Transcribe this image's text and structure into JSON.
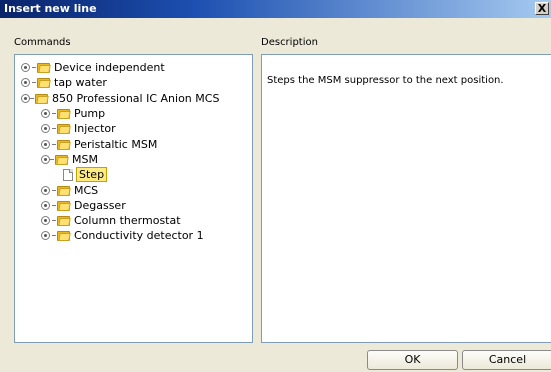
{
  "window": {
    "title": "Insert new line",
    "close_label": "X"
  },
  "commands_label": "Commands",
  "description_label": "Description",
  "description_text": "Steps the MSM suppressor to the next position.",
  "tree": [
    {
      "label": "Device independent",
      "level": 0,
      "type": "folder",
      "expanded": false
    },
    {
      "label": "tap water",
      "level": 0,
      "type": "folder",
      "expanded": false
    },
    {
      "label": "850 Professional IC Anion MCS",
      "level": 0,
      "type": "folder",
      "expanded": true
    },
    {
      "label": "Pump",
      "level": 1,
      "type": "folder",
      "expanded": false
    },
    {
      "label": "Injector",
      "level": 1,
      "type": "folder",
      "expanded": false
    },
    {
      "label": "Peristaltic MSM",
      "level": 1,
      "type": "folder",
      "expanded": false
    },
    {
      "label": "MSM",
      "level": 1,
      "type": "folder",
      "expanded": true
    },
    {
      "label": "Step",
      "level": 2,
      "type": "item",
      "selected": true
    },
    {
      "label": "MCS",
      "level": 1,
      "type": "folder",
      "expanded": false
    },
    {
      "label": "Degasser",
      "level": 1,
      "type": "folder",
      "expanded": false
    },
    {
      "label": "Column thermostat",
      "level": 1,
      "type": "folder",
      "expanded": false
    },
    {
      "label": "Conductivity detector 1",
      "level": 1,
      "type": "folder",
      "expanded": false
    }
  ],
  "buttons": {
    "ok": "OK",
    "cancel": "Cancel"
  }
}
